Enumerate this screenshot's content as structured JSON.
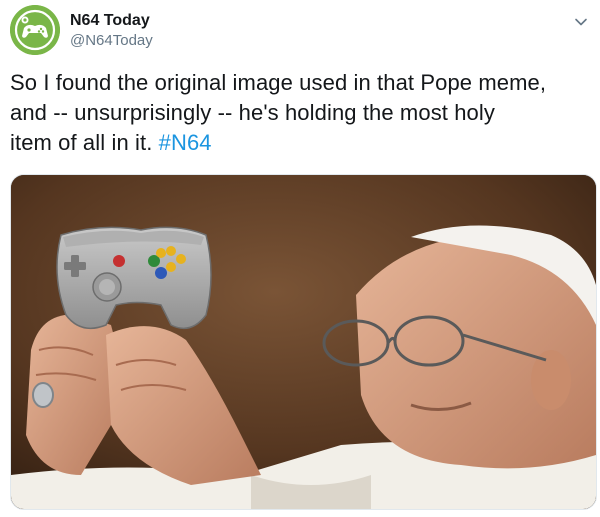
{
  "account": {
    "display_name": "N64 Today",
    "handle": "@N64Today",
    "avatar_icon": "game-controller-icon",
    "avatar_color": "#7ab648"
  },
  "tweet": {
    "text_line1": "So I found the original image used in that Pope meme,",
    "text_line2": "and -- unsurprisingly -- he's holding the most holy",
    "text_line3": "item of all in it. ",
    "hashtag": "#N64"
  },
  "menu_icon": "chevron-down-icon",
  "colors": {
    "hashtag": "#1b95e0",
    "handle": "#657786"
  }
}
